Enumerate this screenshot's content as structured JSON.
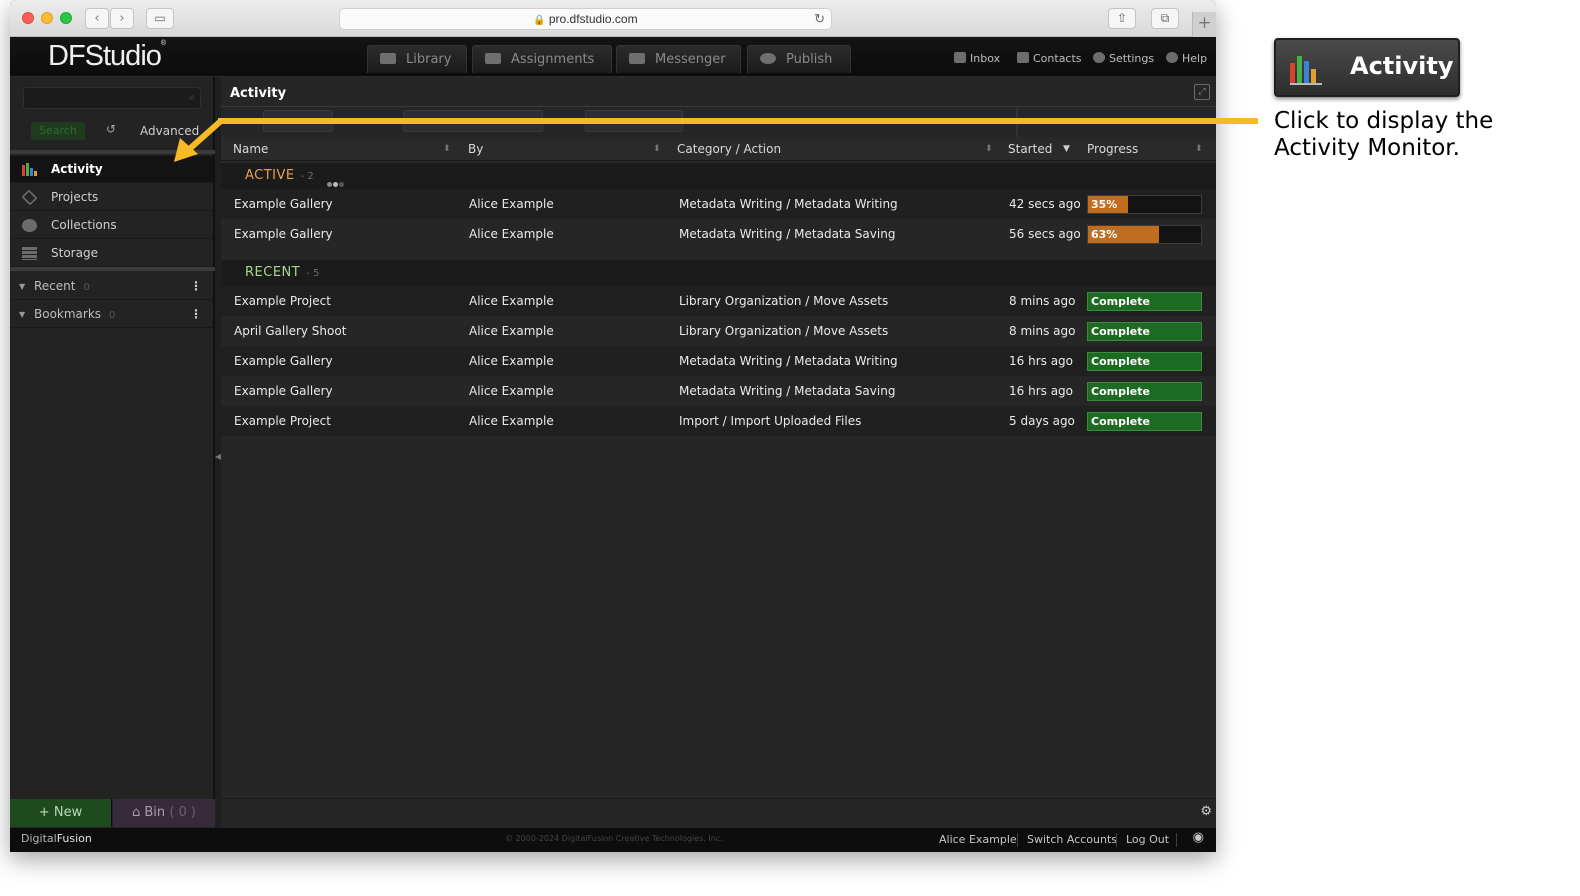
{
  "browser": {
    "url": "pro.dfstudio.com"
  },
  "app": {
    "logo": "DFStudio",
    "tabs": [
      "Library",
      "Assignments",
      "Messenger",
      "Publish"
    ],
    "header_links": [
      "Inbox",
      "Contacts",
      "Settings",
      "Help"
    ]
  },
  "sidebar": {
    "search_label": "Search",
    "advanced_label": "Advanced",
    "items": [
      "Activity",
      "Projects",
      "Collections",
      "Storage"
    ],
    "groups": [
      {
        "label": "Recent",
        "count": "0"
      },
      {
        "label": "Bookmarks",
        "count": "0"
      }
    ],
    "new_label": "New",
    "bin_label": "Bin",
    "bin_count": "( 0 )"
  },
  "main": {
    "title": "Activity",
    "columns": [
      "Name",
      "By",
      "Category / Action",
      "Started",
      "Progress"
    ],
    "active": {
      "title": "ACTIVE",
      "count": "2",
      "rows": [
        {
          "name": "Example Gallery",
          "by": "Alice Example",
          "action": "Metadata Writing / Metadata Writing",
          "started": "42 secs ago",
          "progress_label": "35%",
          "progress": 0.35
        },
        {
          "name": "Example Gallery",
          "by": "Alice Example",
          "action": "Metadata Writing / Metadata Saving",
          "started": "56 secs ago",
          "progress_label": "63%",
          "progress": 0.63
        }
      ]
    },
    "recent": {
      "title": "RECENT",
      "count": "5",
      "rows": [
        {
          "name": "Example Project",
          "by": "Alice Example",
          "action": "Library Organization / Move Assets",
          "started": "8 mins ago",
          "status": "Complete"
        },
        {
          "name": "April Gallery Shoot",
          "by": "Alice Example",
          "action": "Library Organization / Move Assets",
          "started": "8 mins ago",
          "status": "Complete"
        },
        {
          "name": "Example Gallery",
          "by": "Alice Example",
          "action": "Metadata Writing / Metadata Writing",
          "started": "16 hrs ago",
          "status": "Complete"
        },
        {
          "name": "Example Gallery",
          "by": "Alice Example",
          "action": "Metadata Writing / Metadata Saving",
          "started": "16 hrs ago",
          "status": "Complete"
        },
        {
          "name": "Example Project",
          "by": "Alice Example",
          "action": "Import / Import Uploaded Files",
          "started": "5 days ago",
          "status": "Complete"
        }
      ]
    }
  },
  "footer": {
    "brand_prefix": "Digital",
    "brand_suffix": "Fusion",
    "copyright": "© 2000-2024 DigitalFusion Creative Technologies, Inc.",
    "user": "Alice Example",
    "switch": "Switch Accounts",
    "logout": "Log Out"
  },
  "callout": {
    "button_label": "Activity",
    "text": "Click to display the Activity Monitor."
  },
  "colors": {
    "active_accent": "#e8a050",
    "recent_accent": "#a6d98a",
    "progress_fill": "#c16d1f",
    "complete_fill": "#1d6a22",
    "arrow": "#f7b924"
  }
}
